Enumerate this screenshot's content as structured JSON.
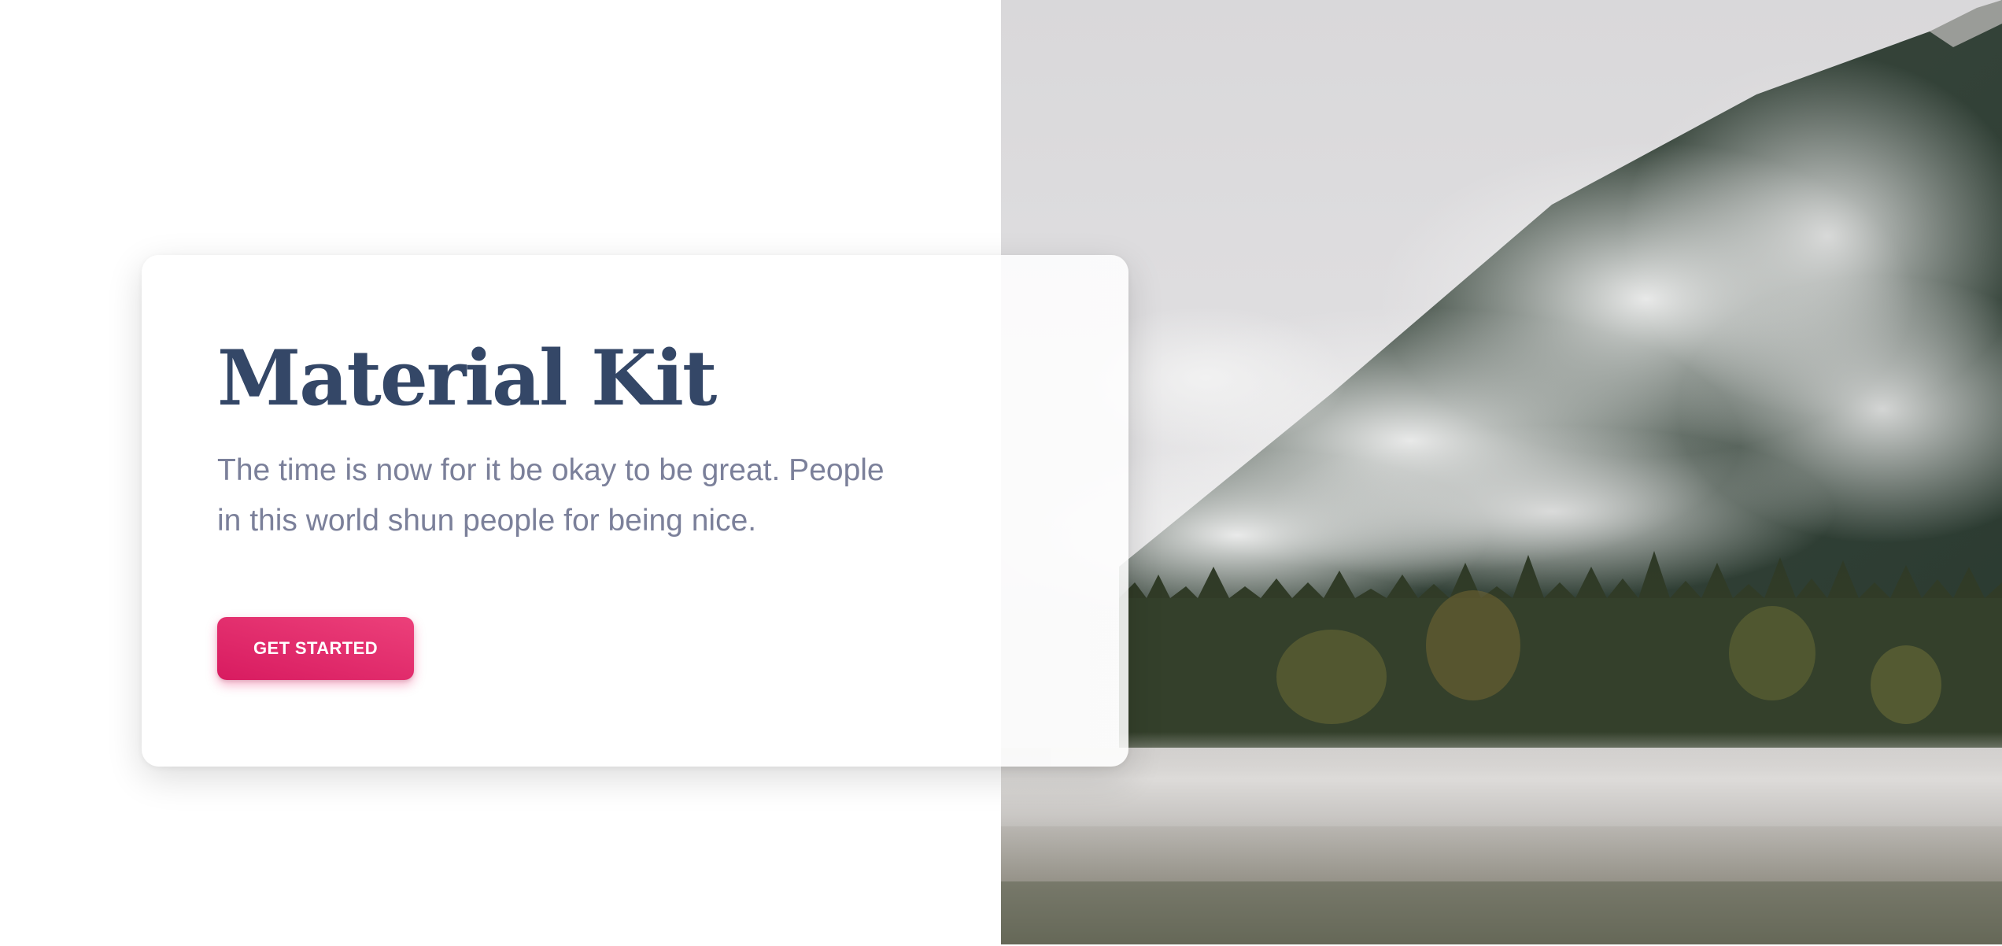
{
  "hero": {
    "title": "Material Kit",
    "description": "The time is now for it be okay to be great. People in this world shun people for being nice.",
    "cta_label": "GET STARTED"
  },
  "colors": {
    "title": "#344767",
    "description": "#7b809a",
    "cta_start": "#ec407a",
    "cta_end": "#d81b60"
  },
  "image": {
    "subject": "misty-mountain-forest-lake-photo"
  }
}
